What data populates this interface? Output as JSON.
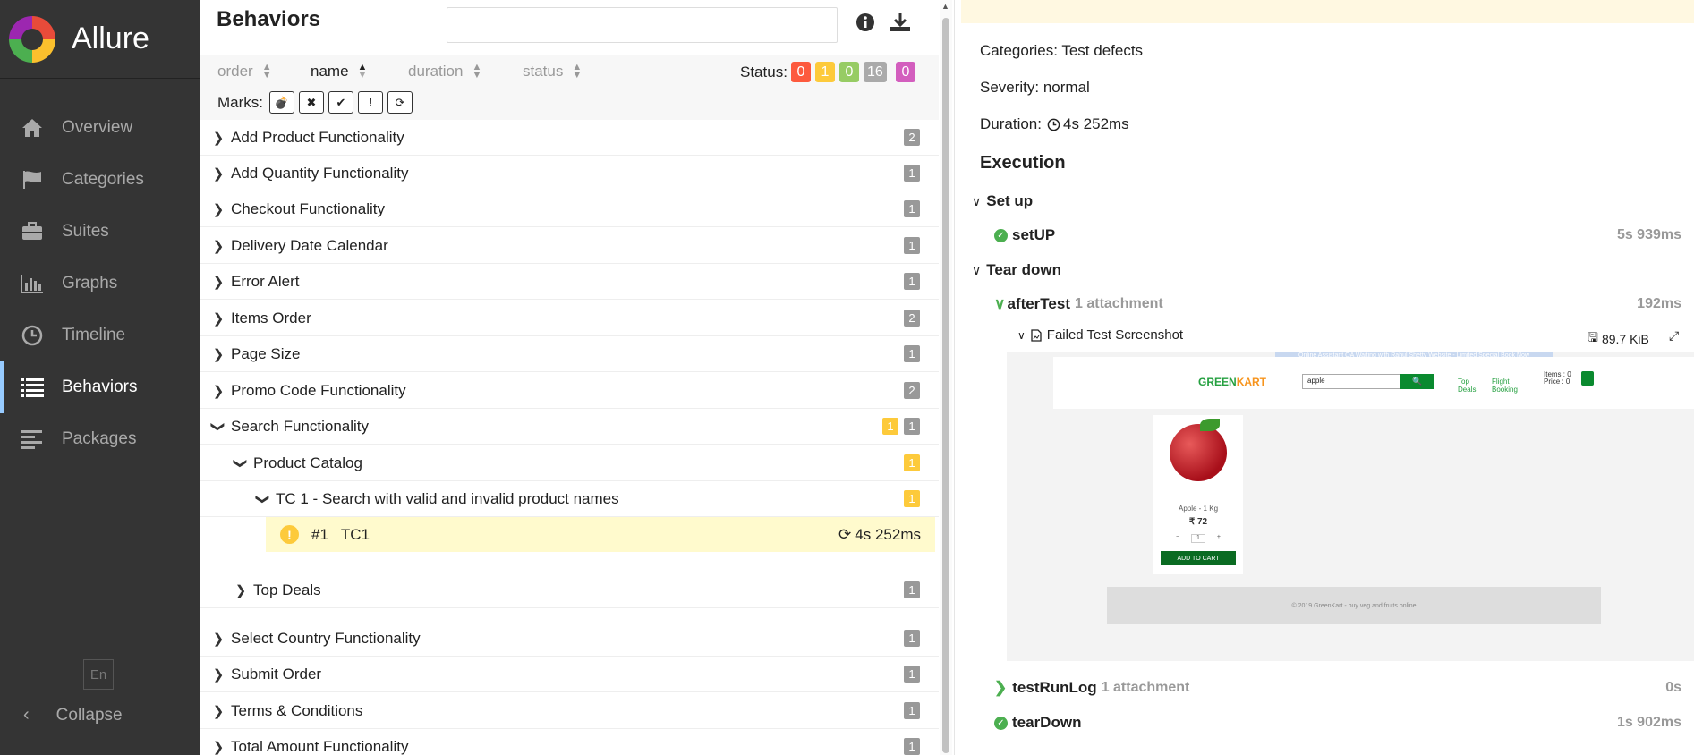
{
  "app": {
    "title": "Allure"
  },
  "sidebar": {
    "items": [
      {
        "label": "Overview",
        "icon": "home-icon"
      },
      {
        "label": "Categories",
        "icon": "flag-icon"
      },
      {
        "label": "Suites",
        "icon": "briefcase-icon"
      },
      {
        "label": "Graphs",
        "icon": "bar-chart-icon"
      },
      {
        "label": "Timeline",
        "icon": "clock-icon"
      },
      {
        "label": "Behaviors",
        "icon": "list-icon",
        "active": true
      },
      {
        "label": "Packages",
        "icon": "align-left-icon"
      }
    ],
    "lang": "En",
    "collapse": "Collapse"
  },
  "behaviors": {
    "title": "Behaviors",
    "search_value": "",
    "sort": {
      "order": "order",
      "name": "name",
      "duration": "duration",
      "status": "status"
    },
    "status_label": "Status:",
    "status_counts": [
      {
        "value": "0",
        "color": "#fd5a3e"
      },
      {
        "value": "1",
        "color": "#fdca3b"
      },
      {
        "value": "0",
        "color": "#97cc64"
      },
      {
        "value": "16",
        "color": "#aaaaaa"
      },
      {
        "value": "0",
        "color": "#d35ebe"
      }
    ],
    "marks_label": "Marks:",
    "marks": [
      "💣",
      "✖",
      "✔",
      "!",
      "⟳"
    ],
    "rows": [
      {
        "label": "Add Product Functionality",
        "count": "2"
      },
      {
        "label": "Add Quantity Functionality",
        "count": "1"
      },
      {
        "label": "Checkout Functionality",
        "count": "1"
      },
      {
        "label": "Delivery Date Calendar",
        "count": "1"
      },
      {
        "label": "Error Alert",
        "count": "1"
      },
      {
        "label": "Items Order",
        "count": "2"
      },
      {
        "label": "Page Size",
        "count": "1"
      },
      {
        "label": "Promo Code Functionality",
        "count": "2"
      },
      {
        "label": "Search Functionality",
        "count": "1",
        "yellow": "1"
      },
      {
        "label": "Product Catalog",
        "yellow": "1"
      },
      {
        "label": "TC 1 - Search with valid and invalid product names",
        "yellow": "1"
      },
      {
        "label": "Top Deals",
        "count": "1"
      },
      {
        "label": "Select Country Functionality",
        "count": "1"
      },
      {
        "label": "Submit Order",
        "count": "1"
      },
      {
        "label": "Terms & Conditions",
        "count": "1"
      },
      {
        "label": "Total Amount Functionality",
        "count": "1"
      }
    ],
    "selected": {
      "num": "#1",
      "name": "TC1",
      "duration": "4s 252ms"
    }
  },
  "detail": {
    "categories": "Categories: Test defects",
    "severity": "Severity: normal",
    "duration_label": "Duration:",
    "duration": "4s 252ms",
    "execution": "Execution",
    "setup": "Set up",
    "setup_step": {
      "name": "setUP",
      "time": "5s 939ms"
    },
    "teardown": "Tear down",
    "after_test": {
      "name": "afterTest",
      "attach": "1 attachment",
      "time": "192ms"
    },
    "attachment": {
      "name": "Failed Test Screenshot",
      "size": "89.7 KiB"
    },
    "test_run_log": {
      "name": "testRunLog",
      "attach": "1 attachment",
      "time": "0s"
    },
    "tear_down": {
      "name": "tearDown",
      "time": "1s 902ms"
    }
  },
  "screenshot": {
    "banner": "Online Assistant QA Waiting with Rahul Shetty Website - Limited Special Book Now",
    "brand_a": "GREEN",
    "brand_b": "KART",
    "search_value": "apple",
    "search_btn": "🔍",
    "top_deals": "Top Deals",
    "flight": "Flight Booking",
    "items": "Items : 0",
    "price": "Price : 0",
    "product": "Apple - 1 Kg",
    "product_price": "₹ 72",
    "add_btn": "ADD TO CART",
    "footer": "© 2019 GreenKart - buy veg and fruits online"
  }
}
